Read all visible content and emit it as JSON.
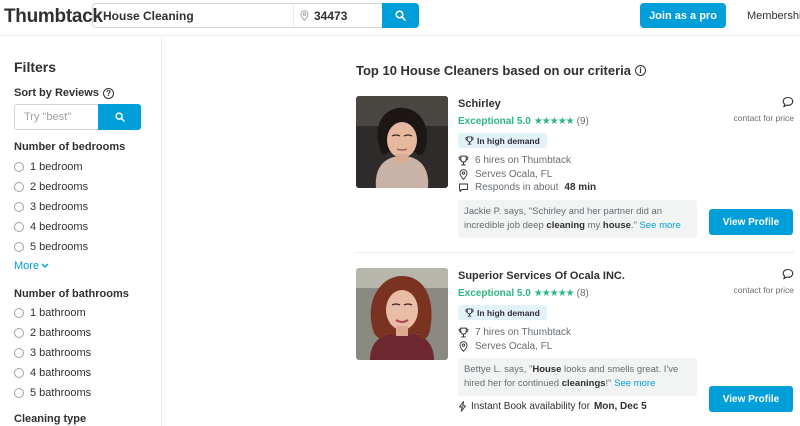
{
  "header": {
    "logo": "Thumbtack",
    "search_query": "House Cleaning",
    "zip": "34473",
    "join_label": "Join as a pro",
    "membership_label": "Membership"
  },
  "sidebar": {
    "title": "Filters",
    "sort_label": "Sort by Reviews",
    "sort_placeholder": "Try \"best\"",
    "bedrooms_title": "Number of bedrooms",
    "bedrooms": [
      "1 bedroom",
      "2 bedrooms",
      "3 bedrooms",
      "4 bedrooms",
      "5 bedrooms"
    ],
    "more_label": "More",
    "bathrooms_title": "Number of bathrooms",
    "bathrooms": [
      "1 bathroom",
      "2 bathrooms",
      "3 bathrooms",
      "4 bathrooms",
      "5 bathrooms"
    ],
    "cleaning_type_title": "Cleaning type"
  },
  "main": {
    "title": "Top 10 House Cleaners based on our criteria",
    "pros": [
      {
        "name": "Schirley",
        "rating_word": "Exceptional 5.0",
        "stars": "★★★★★",
        "review_count": "(9)",
        "badge": "In high demand",
        "hires": "6 hires on Thumbtack",
        "serves": "Serves Ocala, FL",
        "responds_prefix": "Responds in about",
        "responds_time": "48 min",
        "quote_a": "Jackie P. says, \"Schirley and her partner did an incredible job deep ",
        "quote_b": "cleaning",
        "quote_c": " my ",
        "quote_d": "house",
        "quote_e": ".\" ",
        "see_more": "See more",
        "price_text": "contact for price",
        "view_label": "View Profile"
      },
      {
        "name": "Superior Services Of Ocala INC.",
        "rating_word": "Exceptional 5.0",
        "stars": "★★★★★",
        "review_count": "(8)",
        "badge": "In high demand",
        "hires": "7 hires on Thumbtack",
        "serves": "Serves Ocala, FL",
        "quote_a": "Bettye L. says, \"",
        "quote_b": "House",
        "quote_c": " looks and smells great. I've hired her for continued ",
        "quote_d": "cleanings",
        "quote_e": "!\" ",
        "see_more": "See more",
        "instant_prefix": "Instant Book availability for",
        "instant_date": "Mon, Dec 5",
        "price_text": "contact for price",
        "view_label": "View Profile"
      }
    ]
  },
  "colors": {
    "accent": "#009fd9",
    "rating_green": "#2db783",
    "text": "#2f3033",
    "muted": "#676d73"
  }
}
